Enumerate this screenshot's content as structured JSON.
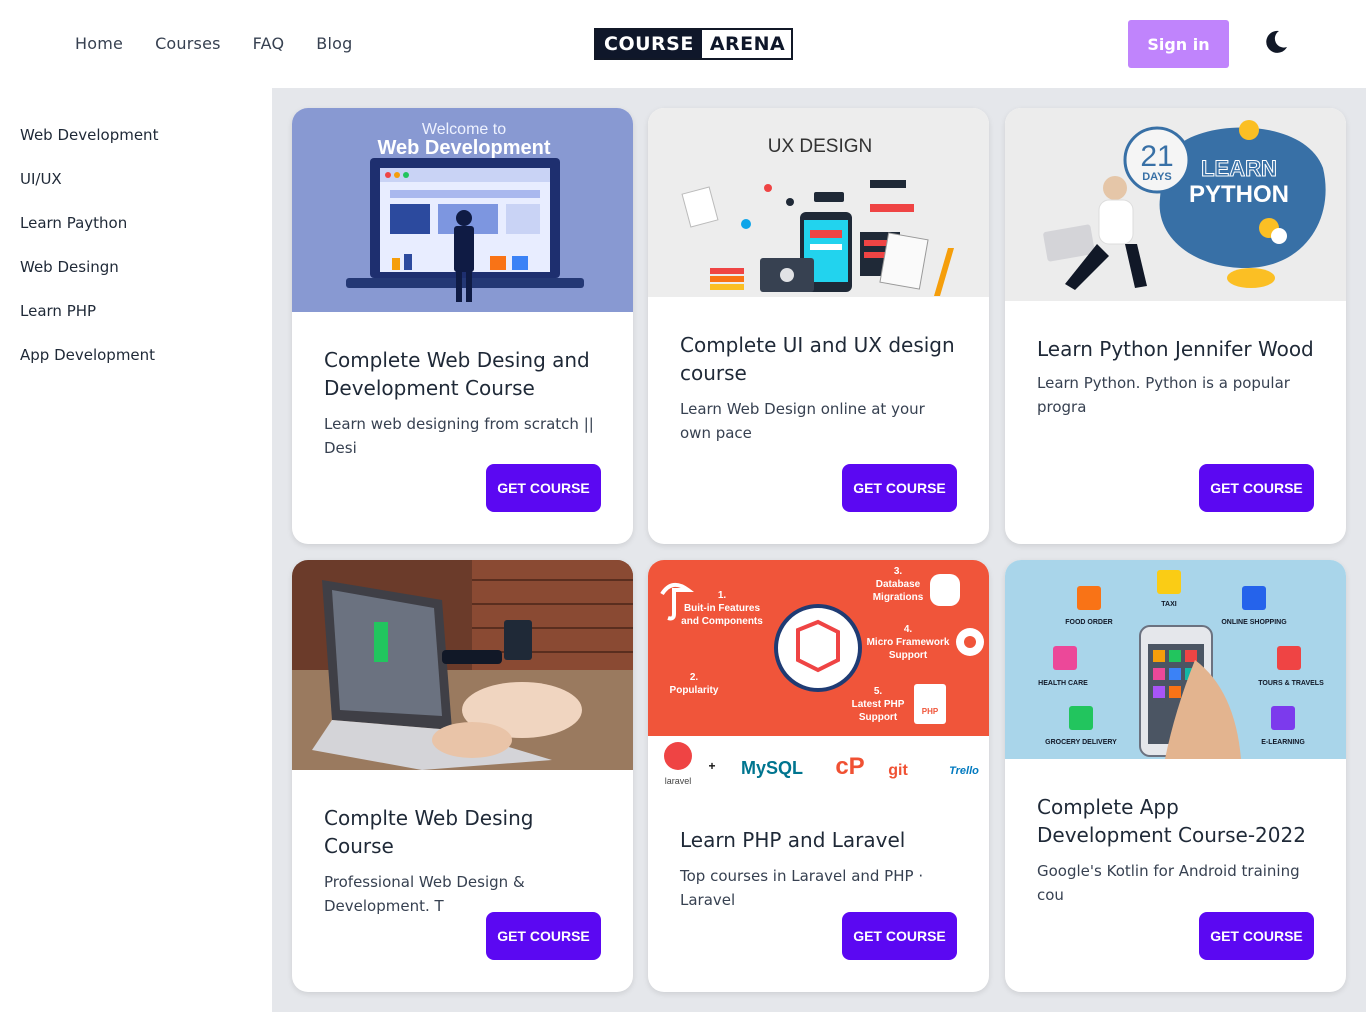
{
  "header": {
    "nav": [
      "Home",
      "Courses",
      "FAQ",
      "Blog"
    ],
    "logo_left": "COURSE",
    "logo_right": "ARENA",
    "signin_label": "Sign in",
    "theme_icon": "moon-icon"
  },
  "sidebar": {
    "items": [
      "Web Development",
      "UI/UX",
      "Learn Paython",
      "Web Desingn",
      "Learn PHP",
      "App Development"
    ]
  },
  "courses": [
    {
      "title": "Complete Web Desing and Development Course",
      "desc": "Learn web designing from scratch || Desi",
      "button": "GET COURSE",
      "image_text": [
        "Welcome to",
        "Web Development"
      ]
    },
    {
      "title": "Complete UI and UX design course",
      "desc": "Learn Web Design online at your own pace",
      "button": "GET COURSE",
      "image_text": [
        "UX DESIGN"
      ]
    },
    {
      "title": "Learn Python Jennifer Wood",
      "desc": "Learn Python. Python is a popular progra",
      "button": "GET COURSE",
      "image_text": [
        "21",
        "DAYS",
        "LEARN",
        "PYTHON"
      ]
    },
    {
      "title": "Complte Web Desing Course",
      "desc": "Professional Web Design & Development. T",
      "button": "GET COURSE",
      "image_text": []
    },
    {
      "title": "Learn PHP and Laravel",
      "desc": "Top courses in Laravel and PHP · Laravel",
      "button": "GET COURSE",
      "image_text": [
        "1.",
        "Buit-in Features",
        "and Components",
        "2.",
        "Popularity",
        "3.",
        "Database",
        "Migrations",
        "4.",
        "Micro Framework",
        "Support",
        "5.",
        "Latest PHP",
        "Support",
        "PHP",
        "laravel",
        "+",
        "MySQL",
        "git",
        "Trello"
      ]
    },
    {
      "title": "Complete App Development Course-2022",
      "desc": "Google's Kotlin for Android training cou",
      "button": "GET COURSE",
      "image_text": [
        "TAXI",
        "FOOD ORDER",
        "ONLINE SHOPPING",
        "HEALTH CARE",
        "TOURS & TRAVELS",
        "GROCERY DELIVERY",
        "E-LEARNING"
      ]
    }
  ],
  "colors": {
    "accent": "#5b08f2",
    "signin": "#c084fc",
    "main_bg": "#e5e7eb"
  }
}
